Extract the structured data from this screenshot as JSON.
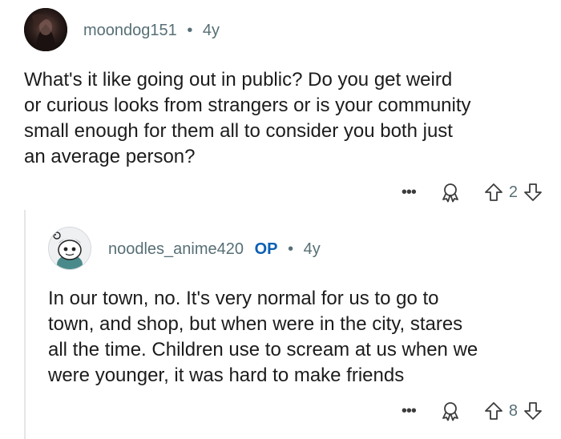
{
  "comments": [
    {
      "username": "moondog151",
      "separator": "•",
      "age": "4y",
      "body_lines": [
        "What's it like going out in public? Do you get weird",
        "or curious looks from strangers or is your community",
        "small enough for them all to consider you both just",
        "an average person?"
      ],
      "votes": "2",
      "more_label": "•••"
    },
    {
      "username": "noodles_anime420",
      "op_badge": "OP",
      "separator": "•",
      "age": "4y",
      "body_lines": [
        "In our town, no. It's very normal for us to go to",
        "town, and shop, but when were in the city, stares",
        "all the time. Children use to scream at us when we",
        "were younger, it was hard to make friends"
      ],
      "votes": "8",
      "more_label": "•••"
    }
  ],
  "icons": {
    "more": "ellipsis-icon",
    "award": "award-icon",
    "upvote": "upvote-arrow-icon",
    "downvote": "downvote-arrow-icon"
  },
  "colors": {
    "meta_text": "#576f76",
    "op_badge": "#0a5fb4",
    "body_text": "#1c1c1c"
  }
}
